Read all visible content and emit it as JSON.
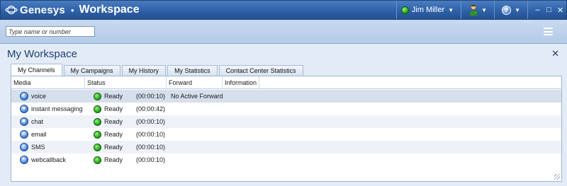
{
  "titlebar": {
    "brand": "Genesys",
    "separator": "•",
    "app": "Workspace",
    "user": "Jim Miller",
    "caret": "▼",
    "help": "?",
    "minimize": "–",
    "maximize": "□",
    "close": "✕"
  },
  "search": {
    "placeholder": "Type name or number"
  },
  "workspace": {
    "title": "My Workspace",
    "close": "✕",
    "tabs": [
      {
        "label": "My Channels"
      },
      {
        "label": "My Campaigns"
      },
      {
        "label": "My History"
      },
      {
        "label": "My Statistics"
      },
      {
        "label": "Contact Center Statistics"
      }
    ]
  },
  "table": {
    "columns": [
      "Media",
      "Status",
      "Forward",
      "Information"
    ],
    "rows": [
      {
        "media": "voice",
        "icon": "phone-icon",
        "status": "Ready",
        "time": "(00:00:10)",
        "forward": "No Active Forward"
      },
      {
        "media": "instant messaging",
        "icon": "chat-bubble-icon",
        "status": "Ready",
        "time": "(00:00:42)",
        "forward": ""
      },
      {
        "media": "chat",
        "icon": "chat-icon",
        "status": "Ready",
        "time": "(00:00:10)",
        "forward": ""
      },
      {
        "media": "email",
        "icon": "email-icon",
        "status": "Ready",
        "time": "(00:00:10)",
        "forward": ""
      },
      {
        "media": "SMS",
        "icon": "sms-icon",
        "status": "Ready",
        "time": "(00:00:10)",
        "forward": ""
      },
      {
        "media": "webcallback",
        "icon": "webcallback-icon",
        "status": "Ready",
        "time": "(00:00:10)",
        "forward": ""
      }
    ]
  },
  "colors": {
    "titlebar": "#2d5fa6",
    "ready": "#2fae1f",
    "accent": "#1f3f74"
  }
}
